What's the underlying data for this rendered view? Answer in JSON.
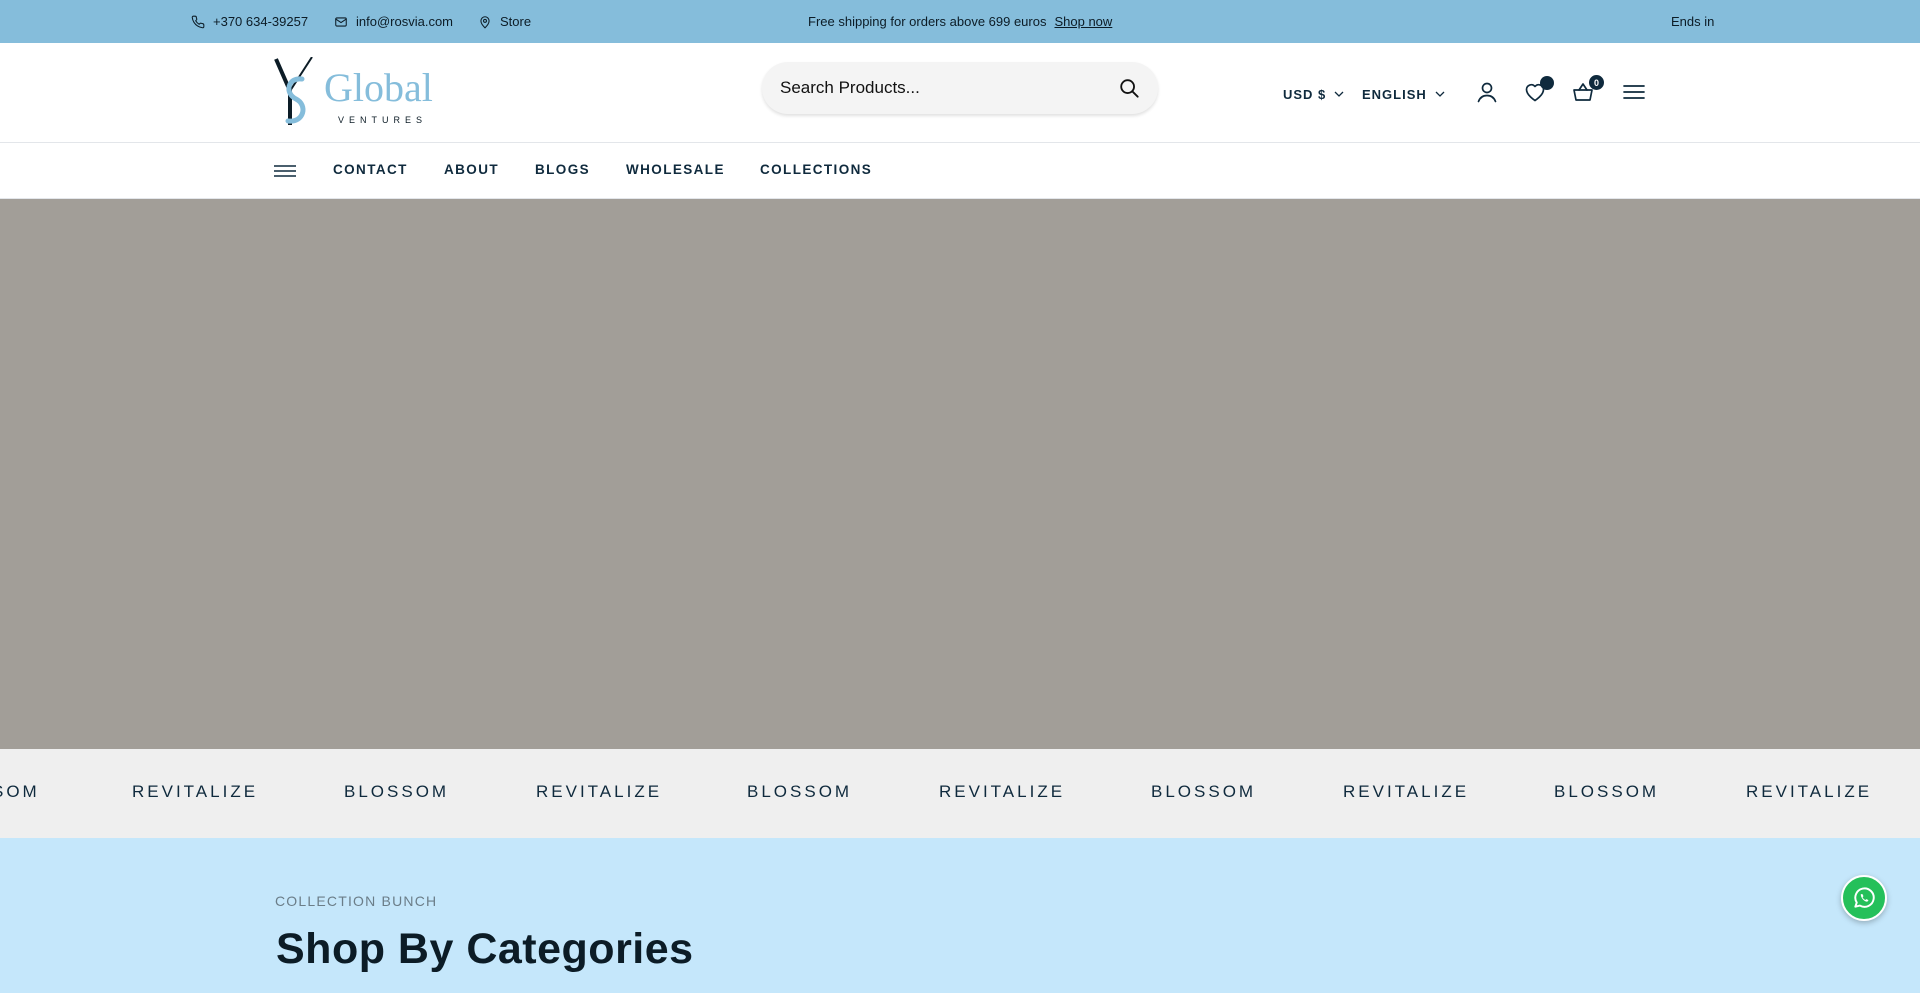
{
  "topbar": {
    "phone": "+370 634-39257",
    "email": "info@rosvia.com",
    "store": "Store",
    "promo_text": "Free shipping for orders above 699 euros",
    "promo_link": "Shop now",
    "ends": "Ends in"
  },
  "logo": {
    "name": "Global",
    "tagline": "VENTURES"
  },
  "search": {
    "placeholder": "Search Products..."
  },
  "header": {
    "currency": "USD $",
    "language": "ENGLISH",
    "cart_count": "0"
  },
  "nav": {
    "items": [
      {
        "label": "CONTACT"
      },
      {
        "label": "ABOUT"
      },
      {
        "label": "BLOGS"
      },
      {
        "label": "WHOLESALE"
      },
      {
        "label": "COLLECTIONS"
      }
    ]
  },
  "marquee": {
    "words": [
      "SOM",
      "REVITALIZE",
      "BLOSSOM",
      "REVITALIZE",
      "BLOSSOM",
      "REVITALIZE",
      "BLOSSOM",
      "REVITALIZE",
      "BLOSSOM",
      "REVITALIZE"
    ]
  },
  "categories": {
    "eyebrow": "COLLECTION BUNCH",
    "title": "Shop By Categories"
  },
  "colors": {
    "topbar": "#85bddb",
    "accent_dark": "#0f2a3d",
    "hero": "#a29e98",
    "marquee_bg": "#efefef",
    "categories_bg": "#c5e7fb",
    "whatsapp": "#25c05a"
  },
  "icons": [
    "phone-icon",
    "mail-icon",
    "location-pin-icon",
    "search-icon",
    "chevron-down-icon",
    "user-icon",
    "heart-icon",
    "cart-icon",
    "menu-icon",
    "whatsapp-icon"
  ]
}
